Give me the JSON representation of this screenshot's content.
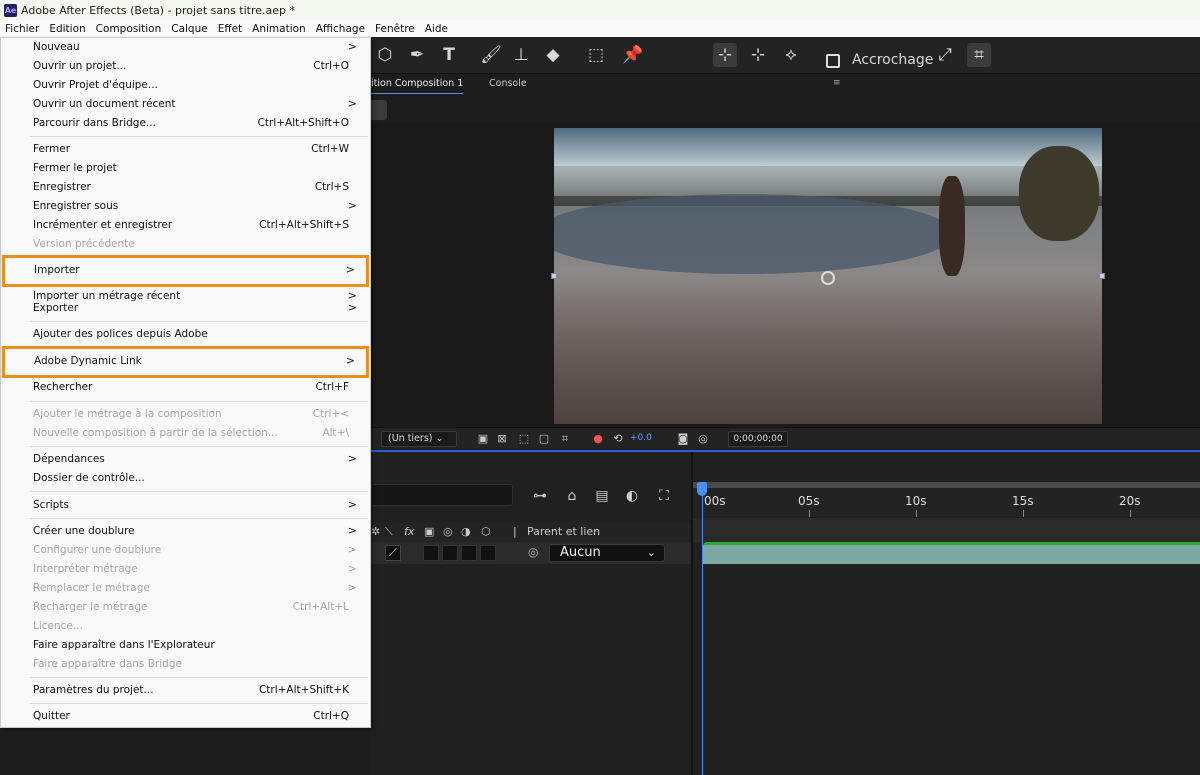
{
  "window": {
    "title": "Adobe After Effects (Beta) - projet sans titre.aep *",
    "app_icon": "Ae"
  },
  "menubar": [
    "Fichier",
    "Edition",
    "Composition",
    "Calque",
    "Effet",
    "Animation",
    "Affichage",
    "Fenêtre",
    "Aide"
  ],
  "toolbar": {
    "snap_label": "Accrochage",
    "snap_checked": false
  },
  "tabs": {
    "composition": "ition Composition 1",
    "console": "Console"
  },
  "viewer": {
    "magnification": "(Un tiers)",
    "exposure": "+0.0",
    "timecode": "0;00;00;00"
  },
  "timeline": {
    "ruler": [
      "00s",
      "05s",
      "10s",
      "15s",
      "20s"
    ],
    "parent_header": "Parent et lien",
    "parent_value": "Aucun"
  },
  "menu": {
    "items": [
      {
        "label": "Nouveau",
        "arrow": ">"
      },
      {
        "label": "Ouvrir un projet...",
        "shortcut": "Ctrl+O"
      },
      {
        "label": "Ouvrir Projet d'équipe..."
      },
      {
        "label": "Ouvrir un document récent",
        "arrow": ">"
      },
      {
        "label": "Parcourir dans Bridge...",
        "shortcut": "Ctrl+Alt+Shift+O"
      },
      {
        "label": "Fermer",
        "shortcut": "Ctrl+W"
      },
      {
        "label": "Fermer le projet"
      },
      {
        "label": "Enregistrer",
        "shortcut": "Ctrl+S"
      },
      {
        "label": "Enregistrer sous",
        "arrow": ">"
      },
      {
        "label": "Incrémenter et enregistrer",
        "shortcut": "Ctrl+Alt+Shift+S"
      },
      {
        "label": "Version précédente",
        "disabled": true
      },
      {
        "label": "Importer",
        "arrow": ">",
        "highlighted": true
      },
      {
        "label": "Importer un métrage récent",
        "arrow": ">"
      },
      {
        "label": "Exporter",
        "arrow": ">"
      },
      {
        "label": "Ajouter des polices depuis Adobe"
      },
      {
        "label": "Adobe Dynamic Link",
        "arrow": ">",
        "highlighted": true
      },
      {
        "label": "Rechercher",
        "shortcut": "Ctrl+F"
      },
      {
        "label": "Ajouter le métrage à la composition",
        "shortcut": "Ctrl+<",
        "disabled": true
      },
      {
        "label": "Nouvelle composition à partir de la sélection...",
        "shortcut": "Alt+\\",
        "disabled": true
      },
      {
        "label": "Dépendances",
        "arrow": ">"
      },
      {
        "label": "Dossier de contrôle..."
      },
      {
        "label": "Scripts",
        "arrow": ">"
      },
      {
        "label": "Créer une doublure",
        "arrow": ">"
      },
      {
        "label": "Configurer une doublure",
        "arrow": ">",
        "disabled": true
      },
      {
        "label": "Interpréter métrage",
        "arrow": ">",
        "disabled": true
      },
      {
        "label": "Remplacer le métrage",
        "arrow": ">",
        "disabled": true
      },
      {
        "label": "Recharger le métrage",
        "shortcut": "Ctrl+Alt+L",
        "disabled": true
      },
      {
        "label": "Licence...",
        "disabled": true
      },
      {
        "label": "Faire apparaître dans l'Explorateur"
      },
      {
        "label": "Faire apparaître dans Bridge",
        "disabled": true
      },
      {
        "label": "Paramètres du projet...",
        "shortcut": "Ctrl+Alt+Shift+K"
      },
      {
        "label": "Quitter",
        "shortcut": "Ctrl+Q"
      }
    ]
  },
  "colors": {
    "highlight": "#ea8f1e",
    "accent": "#4a8dff",
    "track": "#7aa9a2"
  }
}
